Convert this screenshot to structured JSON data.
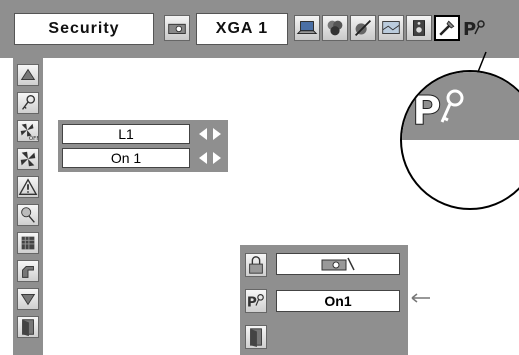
{
  "menu": {
    "title": "Security",
    "resolution": "XGA 1",
    "top_icons": [
      "projector-icon",
      "laptop-icon",
      "color-icon",
      "image-adjust-icon",
      "screen-icon",
      "sound-icon",
      "setting-icon",
      "security-icon"
    ],
    "active_top_icon": "setting-icon"
  },
  "sidebar": {
    "icons": [
      "up-arrow-icon",
      "key-icon",
      "fan-off-icon",
      "fan-icon",
      "warning-icon",
      "pin-icon",
      "grid-icon",
      "hand-icon",
      "down-arrow-icon",
      "exit-icon"
    ]
  },
  "submenu": {
    "fields": [
      {
        "value": "L1"
      },
      {
        "value": "On 1"
      }
    ]
  },
  "dialog": {
    "rows": [
      {
        "icon": "lock-icon",
        "value": ""
      },
      {
        "icon": "pin-key-icon",
        "value": "On1"
      },
      {
        "icon": "exit-icon",
        "value": ""
      }
    ]
  },
  "colors": {
    "panel": "#8f8f8f",
    "field": "#ffffff",
    "border": "#444444"
  }
}
